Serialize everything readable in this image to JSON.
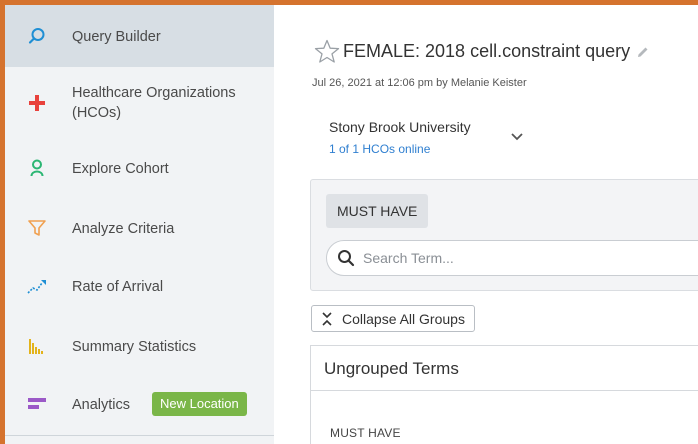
{
  "sidebar": {
    "items": [
      {
        "label": "Query Builder",
        "icon": "search-icon",
        "active": true
      },
      {
        "label": "Healthcare Organizations (HCOs)",
        "icon": "plus-icon"
      },
      {
        "label": "Explore Cohort",
        "icon": "cohort-icon"
      },
      {
        "label": "Analyze Criteria",
        "icon": "funnel-icon"
      },
      {
        "label": "Rate of Arrival",
        "icon": "trend-icon"
      },
      {
        "label": "Summary Statistics",
        "icon": "bar-chart-icon"
      },
      {
        "label": "Analytics",
        "icon": "analytics-icon",
        "badge": "New Location"
      }
    ]
  },
  "query": {
    "title": "FEMALE: 2018 cell.constraint query",
    "meta": "Jul 26, 2021 at 12:06 pm by Melanie Keister"
  },
  "hco": {
    "name": "Stony Brook University",
    "status": "1 of 1 HCOs online"
  },
  "criteria": {
    "must_have": "MUST HAVE",
    "search_placeholder": "Search Term..."
  },
  "actions": {
    "collapse_all": "Collapse All Groups"
  },
  "group": {
    "title": "Ungrouped Terms",
    "must_have": "MUST HAVE"
  },
  "colors": {
    "accent_border": "#d5732e",
    "link": "#2f7fd0",
    "badge": "#7ab648"
  }
}
